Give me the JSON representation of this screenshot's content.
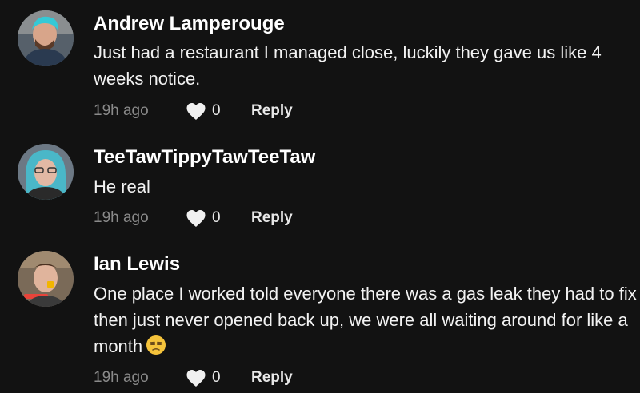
{
  "comments": [
    {
      "username": "Andrew Lamperouge",
      "text": "Just had a restaurant I managed close, luckily they gave us like 4 weeks notice.",
      "time": "19h ago",
      "likes": "0",
      "reply": "Reply",
      "avatar_color": "#3b4c5c"
    },
    {
      "username": "TeeTawTippyTawTeeTaw",
      "text": "He real",
      "time": "19h ago",
      "likes": "0",
      "reply": "Reply",
      "avatar_color": "#5c6a78"
    },
    {
      "username": "Ian Lewis",
      "text": "One place I worked told everyone there was a gas leak they had to fix then just never opened back up, we were all waiting around for like a month",
      "emoji": "unamused-face",
      "time": "19h ago",
      "likes": "0",
      "reply": "Reply",
      "avatar_color": "#6b5a4a"
    }
  ],
  "colors": {
    "background": "#121212",
    "text": "#ffffff",
    "muted": "#8a8a8a"
  }
}
